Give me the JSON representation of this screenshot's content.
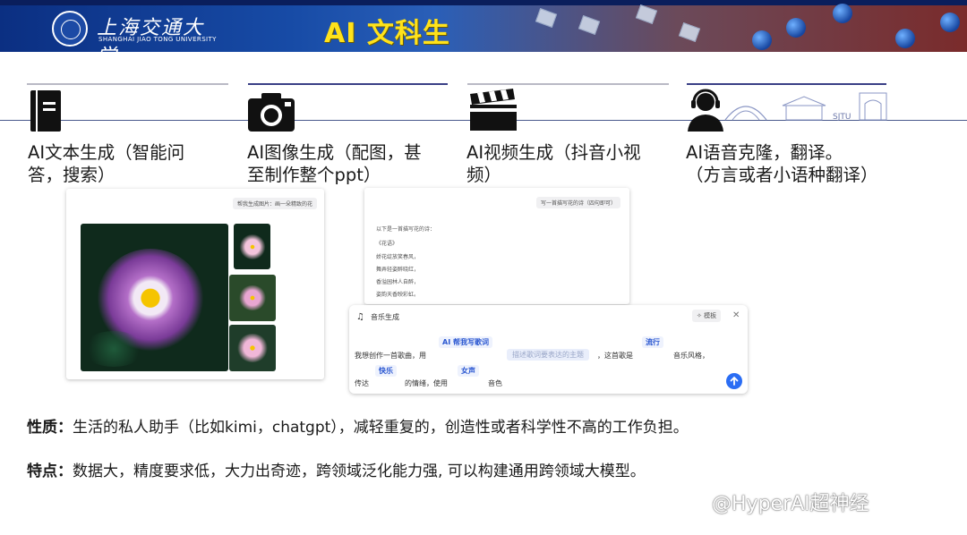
{
  "banner": {
    "university_cn": "上海交通大学",
    "university_en": "SHANGHAI JIAO TONG UNIVERSITY",
    "title": "AI 文科生"
  },
  "categories": [
    {
      "icon": "notebook-icon",
      "line1": "AI文本生成（智能问",
      "line2": "答，搜索）"
    },
    {
      "icon": "camera-icon",
      "line1": "AI图像生成（配图，甚",
      "line2": "至制作整个ppt）"
    },
    {
      "icon": "clapperboard-icon",
      "line1": "AI视频生成（抖音小视",
      "line2": "频）"
    },
    {
      "icon": "support-agent-icon",
      "line1": "AI语音克隆，翻译。",
      "line2": "（方言或者小语种翻译）"
    }
  ],
  "card_image": {
    "prompt_chip": "帮我生成图片：画一朵精致的花"
  },
  "card_poem": {
    "prompt_chip": "写一首描写花的诗（四句即可）",
    "lines": [
      "以下是一首描写花的诗：",
      "《花语》",
      "娇花绽放笑春风，",
      "舞弄轻姿醉晓红，",
      "香溢园林人自醉，",
      "姿韵天香映彩虹。"
    ]
  },
  "music_panel": {
    "title": "音乐生成",
    "mode_button": "✧ 模板",
    "row1_prefix": "我想创作一首歌曲，用",
    "tag_ai": "AI 帮我写歌词",
    "placeholder": "描述歌词要表达的主题",
    "row1_middle": "，这首歌是",
    "tag_style": "流行",
    "row1_suffix": "音乐风格，",
    "row2_prefix": "传达",
    "tag_mood": "快乐",
    "row2_middle": "的情绪，使用",
    "tag_voice": "女声",
    "row2_suffix": "音色"
  },
  "nature": {
    "label": "性质：",
    "text": "生活的私人助手（比如kimi，chatgpt），减轻重复的，创造性或者科学性不高的工作负担。"
  },
  "features": {
    "label": "特点：",
    "text": "数据大，精度要求低，大力出奇迹，跨领域泛化能力强, 可以构建通用跨领域大模型。"
  },
  "watermark": "@HyperAI超神经",
  "colors": {
    "banner_blue": "#174ba6",
    "title_yellow": "#ffe21a",
    "send_blue": "#2a6df4"
  }
}
